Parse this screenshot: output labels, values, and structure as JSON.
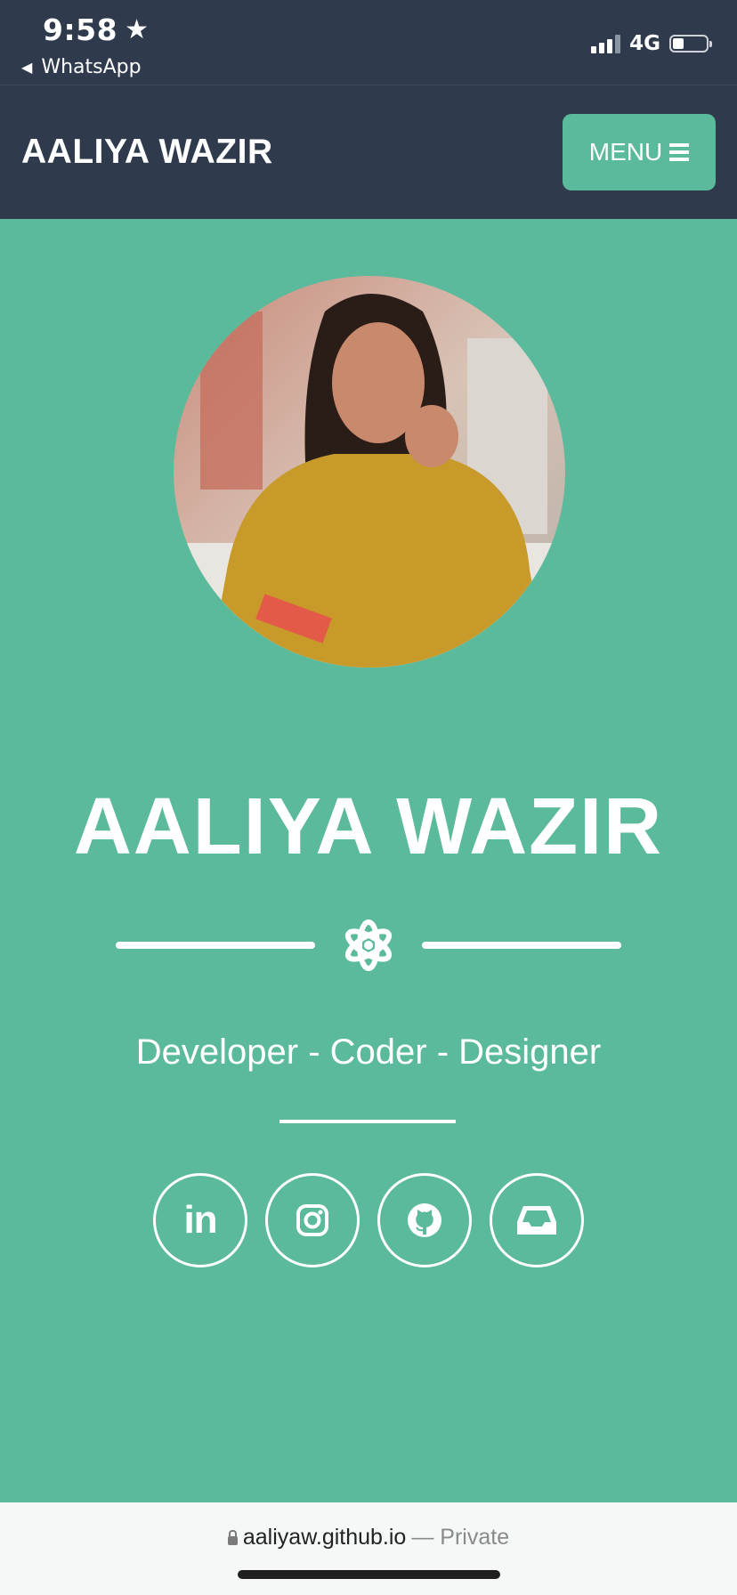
{
  "status_bar": {
    "time": "9:58",
    "back_app": "WhatsApp",
    "network": "4G",
    "signal_bars": 3,
    "battery_level": 0.25
  },
  "navbar": {
    "brand": "AALIYA WAZIR",
    "menu_label": "MENU"
  },
  "hero": {
    "avatar_icon": "profile-photo",
    "name": "AALIYA WAZIR",
    "divider_icon": "atom-icon",
    "tagline": "Developer - Coder - Designer"
  },
  "social_links": [
    {
      "icon": "linkedin-icon",
      "label": "in"
    },
    {
      "icon": "instagram-icon"
    },
    {
      "icon": "github-icon"
    },
    {
      "icon": "inbox-icon"
    }
  ],
  "browser": {
    "url": "aaliyaw.github.io",
    "mode": "— Private"
  },
  "colors": {
    "primary_dark": "#2f3b4d",
    "accent": "#5bba9b",
    "text_light": "#ffffff"
  }
}
